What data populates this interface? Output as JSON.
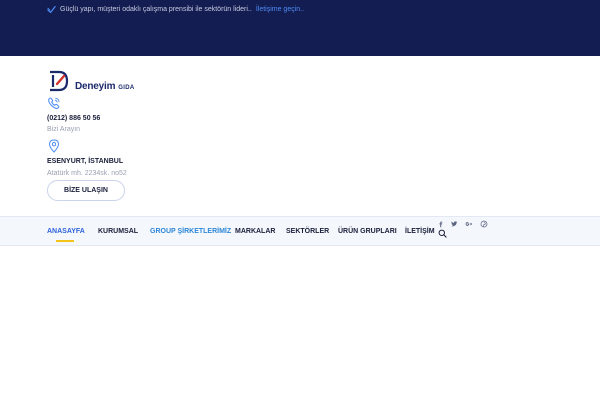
{
  "topbar": {
    "tagline": "Güçlü yapı, müşteri odaklı çalışma prensibi ile sektörün lideri..",
    "contact_link": "İletişime geçin.."
  },
  "brand": {
    "name": "Deneyim",
    "suffix": "GIDA"
  },
  "contact": {
    "phone": "(0212) 886 50 56",
    "phone_caption": "Bizi Arayın",
    "city": "ESENYURT, İSTANBUL",
    "address": "Atatürk mh. 2234sk. no52"
  },
  "cta": {
    "label": "BİZE ULAŞIN"
  },
  "nav": {
    "items": [
      "ANASAYFA",
      "KURUMSAL",
      "GROUP ŞİRKETLERİMİZ",
      "MARKALAR",
      "SEKTÖRLER",
      "ÜRÜN GRUPLARI",
      "İLETİŞİM"
    ]
  },
  "social": {
    "icons": [
      "facebook-icon",
      "twitter-icon",
      "google-plus-icon",
      "pinterest-icon"
    ]
  },
  "colors": {
    "topbar_bg": "#141d52",
    "link": "#4d8cf5",
    "nav_active": "#2d62d9",
    "nav_underline": "#f0c419",
    "brand": "#1c2a6b"
  }
}
